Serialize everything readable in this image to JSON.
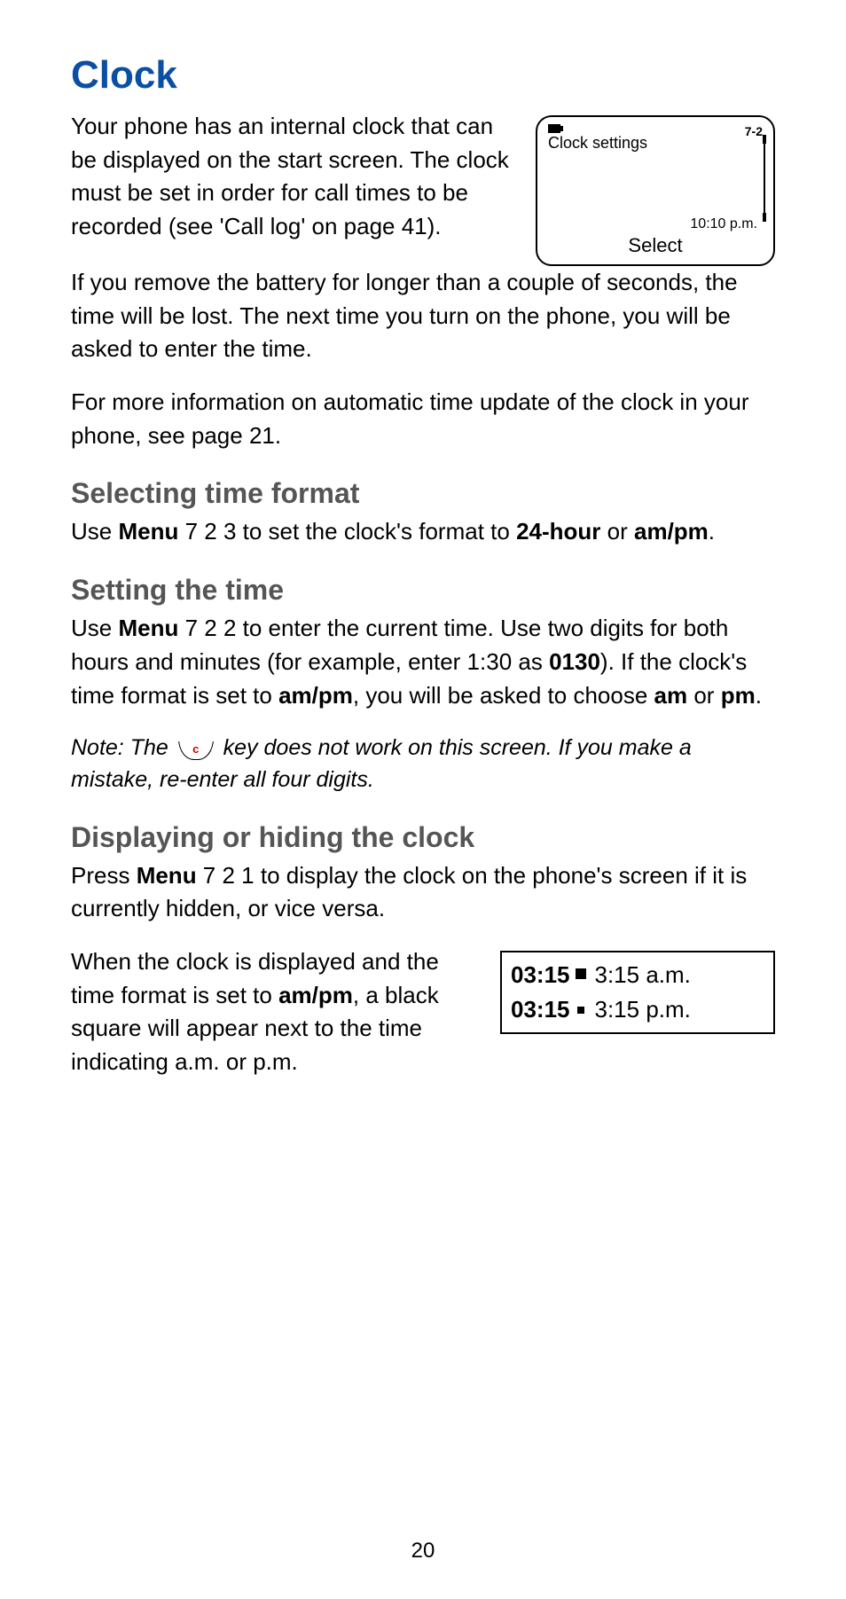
{
  "title": "Clock",
  "intro_left": "Your phone has an internal clock that can be displayed on the start screen. The clock must be set in order for call times to be recorded (see 'Call log' on page 41).",
  "phone": {
    "menu_title": "Clock settings",
    "menu_number": "7-2",
    "time": "10:10 p.m.",
    "softkey": "Select"
  },
  "para2": "If you remove the battery for longer than a couple of seconds, the time will be lost. The next time you turn on the phone, you will be asked to enter the time.",
  "para3": "For more information on automatic time update of the clock in your phone, see page 21.",
  "sec1": {
    "title": "Selecting time format",
    "p_pre": "Use ",
    "p_menu": "Menu",
    "p_mid": " 7 2 3 to set the clock's format to ",
    "p_24": "24-hour",
    "p_or": " or ",
    "p_ampm": "am/pm",
    "p_end": "."
  },
  "sec2": {
    "title": "Setting the time",
    "p_pre": "Use ",
    "p_menu": "Menu",
    "p_a": " 7 2 2 to enter the current time. Use two digits for both hours and minutes (for example, enter 1:30 as ",
    "p_0130": "0130",
    "p_b": "). If the clock's time format is set to ",
    "p_ampm": "am/pm",
    "p_c": ", you will be asked to choose ",
    "p_am": "am",
    "p_or": " or ",
    "p_pm": "pm",
    "p_end": ".",
    "note_pre": "Note:  The ",
    "note_key": "c",
    "note_post": " key does not work on this screen. If you make a mistake, re-enter all four digits."
  },
  "sec3": {
    "title": "Displaying or hiding the clock",
    "p1_pre": "Press ",
    "p1_menu": "Menu",
    "p1_post": " 7 2 1 to display the clock on the phone's screen if it is currently hidden, or vice versa.",
    "p2_a": "When the clock is displayed and the time format is set to ",
    "p2_ampm": "am/pm",
    "p2_b": ", a black square will appear next to the time indicating a.m. or p.m.",
    "box": {
      "t1_bold": "03:15",
      "t1_plain": " 3:15 a.m.",
      "t2_bold": "03:15",
      "t2_plain": " 3:15 p.m."
    }
  },
  "page_number": "20"
}
